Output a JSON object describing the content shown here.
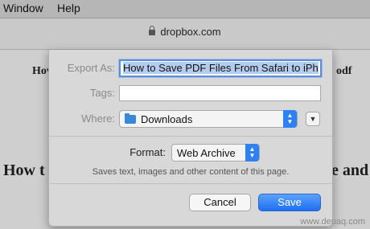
{
  "menubar": {
    "items": [
      "Window",
      "Help"
    ]
  },
  "toolbar": {
    "address": "dropbox.com"
  },
  "background": {
    "heading_left_top": "Hov",
    "heading_right_top": "odf",
    "heading_left_bottom": "How t",
    "heading_right_bottom": "e and"
  },
  "dialog": {
    "export_as_label": "Export As:",
    "export_as_value": "How to Save PDF Files From Safari to iPh",
    "tags_label": "Tags:",
    "tags_value": "",
    "where_label": "Where:",
    "where_value": "Downloads",
    "format_label": "Format:",
    "format_value": "Web Archive",
    "format_description": "Saves text, images and other content of this page.",
    "cancel_label": "Cancel",
    "save_label": "Save"
  },
  "watermark": "www.deuaq.com",
  "colors": {
    "accent": "#2f7ff5",
    "save_button": "#1f6ff2"
  }
}
